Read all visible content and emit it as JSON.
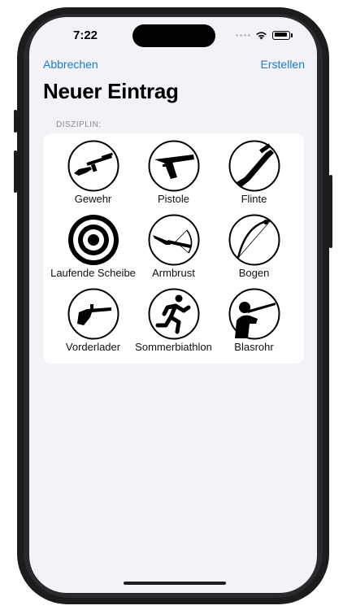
{
  "status_bar": {
    "time": "7:22"
  },
  "nav": {
    "cancel_label": "Abbrechen",
    "create_label": "Erstellen"
  },
  "title": "Neuer Eintrag",
  "section": {
    "label": "DISZIPLIN:"
  },
  "disciplines": [
    {
      "label": "Gewehr",
      "icon": "rifle-icon"
    },
    {
      "label": "Pistole",
      "icon": "pistol-icon"
    },
    {
      "label": "Flinte",
      "icon": "shotgun-icon"
    },
    {
      "label": "Laufende Scheibe",
      "icon": "target-icon"
    },
    {
      "label": "Armbrust",
      "icon": "crossbow-icon"
    },
    {
      "label": "Bogen",
      "icon": "bow-icon"
    },
    {
      "label": "Vorderlader",
      "icon": "muzzleloader-icon"
    },
    {
      "label": "Sommerbiathlon",
      "icon": "runner-icon"
    },
    {
      "label": "Blasrohr",
      "icon": "blowpipe-icon"
    }
  ],
  "colors": {
    "accent": "#1a7ad4",
    "background": "#f2f2f7",
    "card": "#ffffff"
  }
}
